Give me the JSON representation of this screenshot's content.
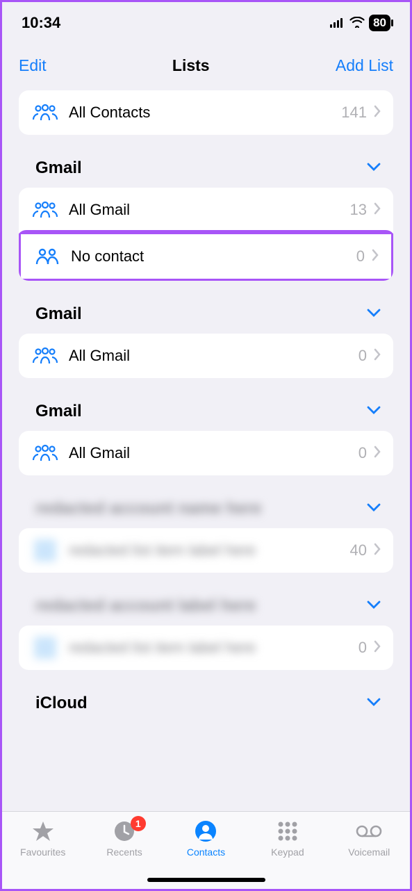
{
  "status": {
    "time": "10:34",
    "battery": "80"
  },
  "nav": {
    "left": "Edit",
    "title": "Lists",
    "right": "Add List"
  },
  "all_contacts": {
    "label": "All Contacts",
    "count": "141"
  },
  "sections": [
    {
      "title": "Gmail",
      "rows": [
        {
          "label": "All Gmail",
          "count": "13",
          "icon": "group3"
        },
        {
          "label": "No contact",
          "count": "0",
          "icon": "group2",
          "highlight": true
        }
      ]
    },
    {
      "title": "Gmail",
      "rows": [
        {
          "label": "All Gmail",
          "count": "0",
          "icon": "group3"
        }
      ]
    },
    {
      "title": "Gmail",
      "rows": [
        {
          "label": "All Gmail",
          "count": "0",
          "icon": "group3"
        }
      ]
    },
    {
      "title": "redacted account name here",
      "blur": true,
      "rows": [
        {
          "label": "redacted list item label here",
          "count": "40",
          "blur": true
        }
      ]
    },
    {
      "title": "redacted account label here",
      "blur": true,
      "rows": [
        {
          "label": "redacted list item label here",
          "count": "0",
          "blur": true
        }
      ]
    },
    {
      "title": "iCloud",
      "rows": []
    }
  ],
  "tabs": {
    "favourites": "Favourites",
    "recents": "Recents",
    "recents_badge": "1",
    "contacts": "Contacts",
    "keypad": "Keypad",
    "voicemail": "Voicemail"
  }
}
